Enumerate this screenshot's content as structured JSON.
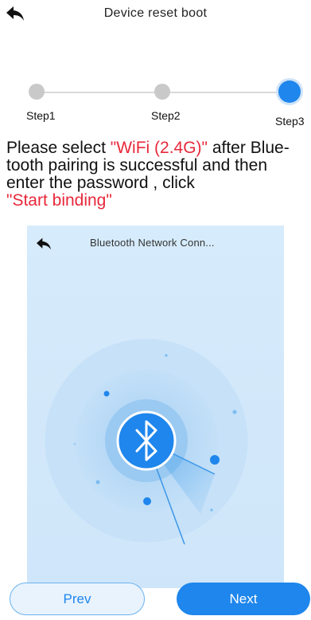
{
  "header": {
    "title": "Device reset boot",
    "back_icon": "back-arrow-icon"
  },
  "stepper": {
    "steps": [
      {
        "label": "Step1",
        "state": "done"
      },
      {
        "label": "Step2",
        "state": "done"
      },
      {
        "label": "Step3",
        "state": "active"
      }
    ],
    "colors": {
      "active": "#1e86ec",
      "inactive": "#c9c9c9"
    }
  },
  "instruction": {
    "part1": "Please select ",
    "wifi": "\"WiFi (2.4G)\"",
    "part2": " after Blue-tooth pairing is successful and then enter the password , click",
    "start": "\"Start binding\""
  },
  "preview": {
    "title": "Bluetooth Network Conn...",
    "back_icon": "back-arrow-icon",
    "center_icon": "bluetooth-icon"
  },
  "buttons": {
    "prev": "Prev",
    "next": "Next"
  },
  "colors": {
    "accent": "#1e86ec",
    "highlight": "#e8283a"
  }
}
